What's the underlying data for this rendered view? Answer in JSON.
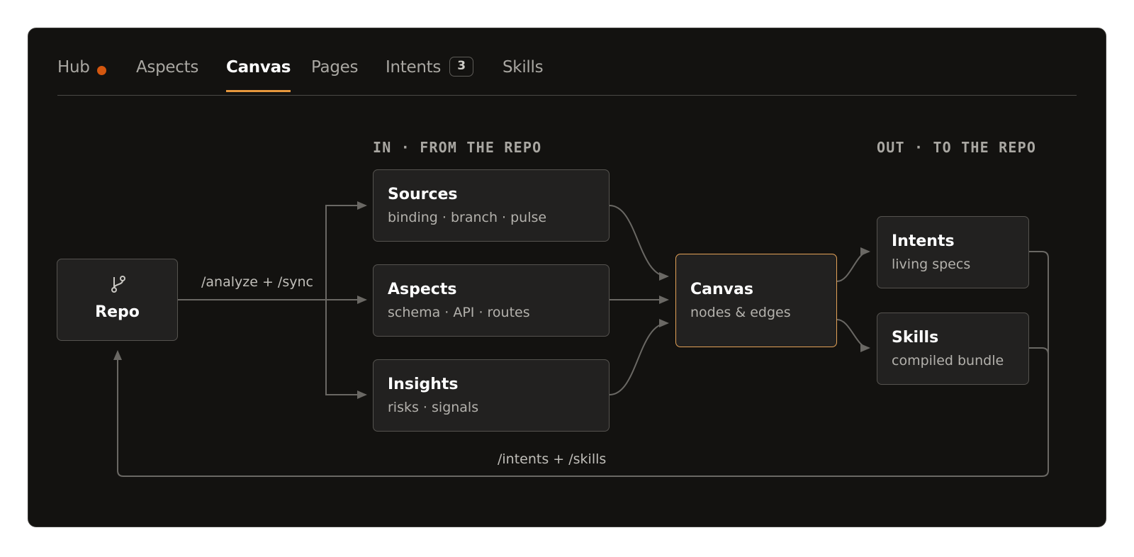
{
  "tabs": [
    {
      "label": "Hub",
      "status_dot": true
    },
    {
      "label": "Aspects"
    },
    {
      "label": "Canvas",
      "active": true
    },
    {
      "label": "Pages"
    },
    {
      "label": "Intents",
      "badge": "3"
    },
    {
      "label": "Skills"
    }
  ],
  "sections": {
    "in_label": "IN · FROM THE REPO",
    "out_label": "OUT · TO THE REPO"
  },
  "nodes": {
    "repo": {
      "title": "Repo",
      "icon": "git-branch-icon"
    },
    "sources": {
      "title": "Sources",
      "subtitle": "binding · branch · pulse"
    },
    "aspects": {
      "title": "Aspects",
      "subtitle": "schema · API · routes"
    },
    "insights": {
      "title": "Insights",
      "subtitle": "risks · signals"
    },
    "canvas": {
      "title": "Canvas",
      "subtitle": "nodes & edges"
    },
    "intents": {
      "title": "Intents",
      "subtitle": "living specs"
    },
    "skills": {
      "title": "Skills",
      "subtitle": "compiled bundle"
    }
  },
  "edges": {
    "in_label": "/analyze + /sync",
    "out_label": "/intents + /skills"
  },
  "colors": {
    "background": "#131210",
    "accent": "#e6973d",
    "status_dot": "#d4570f",
    "node_border": "#55534f",
    "edge": "#6a6864"
  }
}
